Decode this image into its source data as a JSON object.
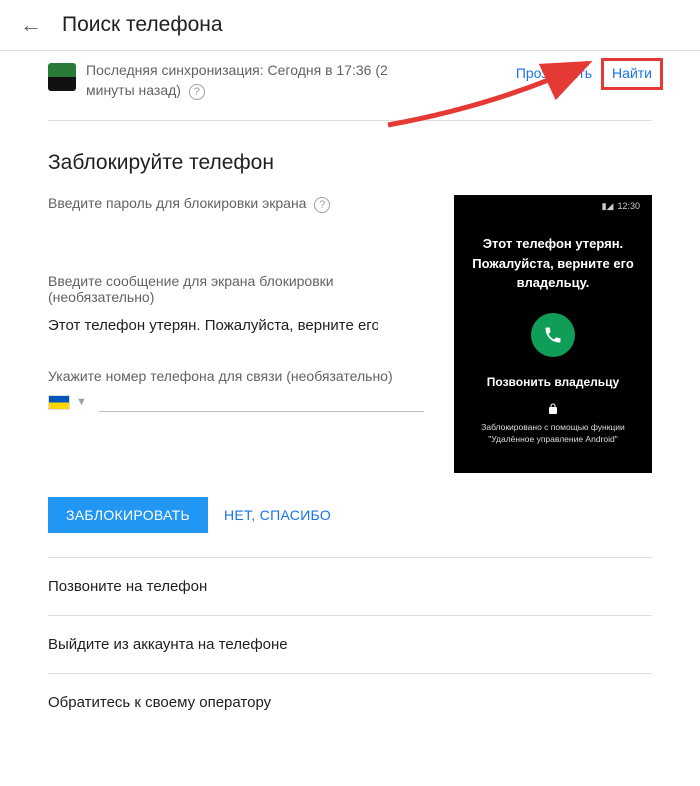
{
  "header": {
    "title": "Поиск телефона"
  },
  "sync": {
    "text": "Последняя синхронизация: Сегодня в 17:36 (2 минуты назад)",
    "ring_label": "Прозвонить",
    "find_label": "Найти"
  },
  "lock": {
    "title": "Заблокируйте телефон",
    "password_label": "Введите пароль для блокировки экрана",
    "message_label": "Введите сообщение для экрана блокировки (необязательно)",
    "message_value": "Этот телефон утерян. Пожалуйста, верните его вл",
    "phone_label": "Укажите номер телефона для связи (необязательно)",
    "lock_button": "ЗАБЛОКИРОВАТЬ",
    "cancel_button": "НЕТ, СПАСИБО"
  },
  "preview": {
    "time": "12:30",
    "lost_line1": "Этот телефон утерян.",
    "lost_line2": "Пожалуйста, верните его",
    "lost_line3": "владельцу.",
    "call_owner": "Позвонить владельцу",
    "locked_line1": "Заблокировано с помощью функции",
    "locked_line2": "\"Удалённое управление Android\""
  },
  "options": {
    "call": "Позвоните на телефон",
    "signout": "Выйдите из аккаунта на телефоне",
    "carrier": "Обратитесь к своему оператору"
  }
}
